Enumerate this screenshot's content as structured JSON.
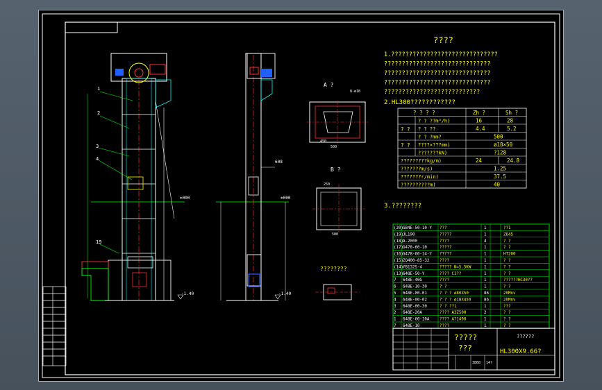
{
  "drawing": {
    "title_block_top": "?????",
    "title_block_sub": "???",
    "model": "HL300X9.66?",
    "right_note": "??????",
    "scale_note": "3868",
    "sheet_note": "14?"
  },
  "views": {
    "view_a": "A ?",
    "view_b": "B ?",
    "detail": "????????",
    "elev_top": "±000",
    "elev_top2": "±000",
    "elev_bottom": "-1.40",
    "elev_bottom2": "-1.40",
    "dim_500": "500",
    "dim_450": "450",
    "dim_250": "250",
    "dim_8": "8-ø18",
    "dim_608": "608"
  },
  "tech": {
    "heading": "????",
    "lines": [
      "1.??????????????????????????????",
      "  ??????????????????????????????",
      "  ??????????????????????????????",
      "  ??????????????????????????????",
      "  ???????????????????????????"
    ],
    "sec2": "2.HL300????????????",
    "sec3": "3.????????"
  },
  "params": {
    "header": [
      "? ? ? ?",
      "Zh ?",
      "Sh ?"
    ],
    "rows": [
      [
        "? ? ??m³/h)",
        "16",
        "28"
      ],
      [
        "? ? ??",
        "4.4",
        "5.2"
      ],
      [
        "? ? ?mm?",
        "500",
        ""
      ],
      [
        "????×???mm)",
        "ø18×50",
        ""
      ],
      [
        "???????kN)",
        "?128",
        ""
      ],
      [
        "?????????kg/m)",
        "24",
        "24.8"
      ],
      [
        "???????m/s)",
        "1.25",
        ""
      ],
      [
        "???????r/min)",
        "37.5",
        ""
      ],
      [
        "??????????m)",
        "40",
        ""
      ]
    ],
    "group_labels": [
      "? ?",
      "? ?"
    ]
  },
  "bom": [
    [
      "(20)",
      "GB4E-50-10-Y",
      "???",
      "1",
      "??1"
    ],
    [
      "(19)",
      "JL190",
      "?????",
      "1",
      "Z645"
    ],
    [
      "(18)",
      "A-2000",
      "????",
      "4",
      "? ?"
    ],
    [
      "(17)",
      "G478-60-10",
      "?????",
      "1",
      "? ?"
    ],
    [
      "(16)",
      "G478-60-14-Y",
      "?????",
      "1",
      "HT200"
    ],
    [
      "(15)",
      "ZQ400-85-32",
      "????",
      "1",
      "? ?"
    ],
    [
      "(14)",
      "YB132S-4",
      "????? N=5.5KW",
      "1",
      "? ?"
    ],
    [
      "(13)",
      "648E-50-Y",
      "???? C1??",
      "1",
      "? ?"
    ],
    [
      "7",
      "648E-40G",
      "????",
      "1",
      "??????HC30??"
    ],
    [
      "6",
      "648E-10-30",
      "? ?",
      "1",
      "? ?"
    ],
    [
      "5",
      "648E-00-01",
      "? ? ? ø80X50",
      "86",
      "20Mnv"
    ],
    [
      "4",
      "648E-00-02",
      "? ? ? ø18X450",
      "86",
      "20Mnv"
    ],
    [
      "3",
      "648E-00-30",
      "? ?  ??1",
      "1",
      "???"
    ],
    [
      "2",
      "648E-20A",
      "???? A3Z500",
      "2",
      "? ?"
    ],
    [
      "1",
      "648E-00-10A",
      "???? A?1490",
      "1",
      "? ?"
    ],
    [
      "?",
      "648E-10",
      "????",
      "1",
      "? ?"
    ]
  ]
}
